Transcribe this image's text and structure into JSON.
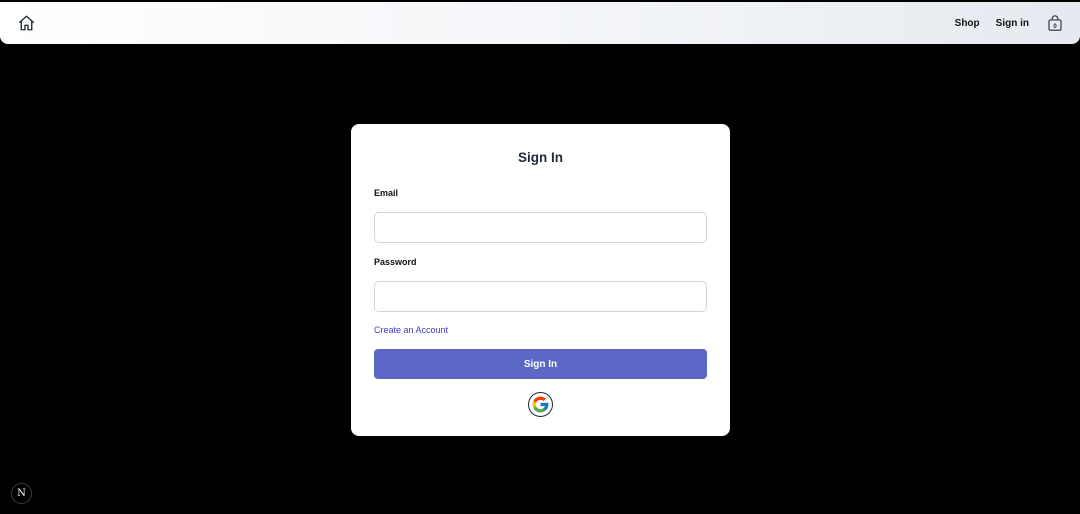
{
  "navbar": {
    "home_icon": "home-icon",
    "links": {
      "shop": "Shop",
      "sign_in": "Sign in"
    },
    "cart_icon": "shopping-bag-icon",
    "cart_count": "0"
  },
  "signin_form": {
    "title": "Sign In",
    "email_label": "Email",
    "email_value": "",
    "password_label": "Password",
    "password_value": "",
    "create_account_link": "Create an Account",
    "submit_label": "Sign In",
    "google_icon": "google-icon"
  },
  "dev_badge": {
    "letter": "N",
    "icon": "nextjs-icon"
  },
  "colors": {
    "page_background": "#000000",
    "card_background": "#ffffff",
    "primary_button": "#5c68c5",
    "link": "#4338ca"
  }
}
